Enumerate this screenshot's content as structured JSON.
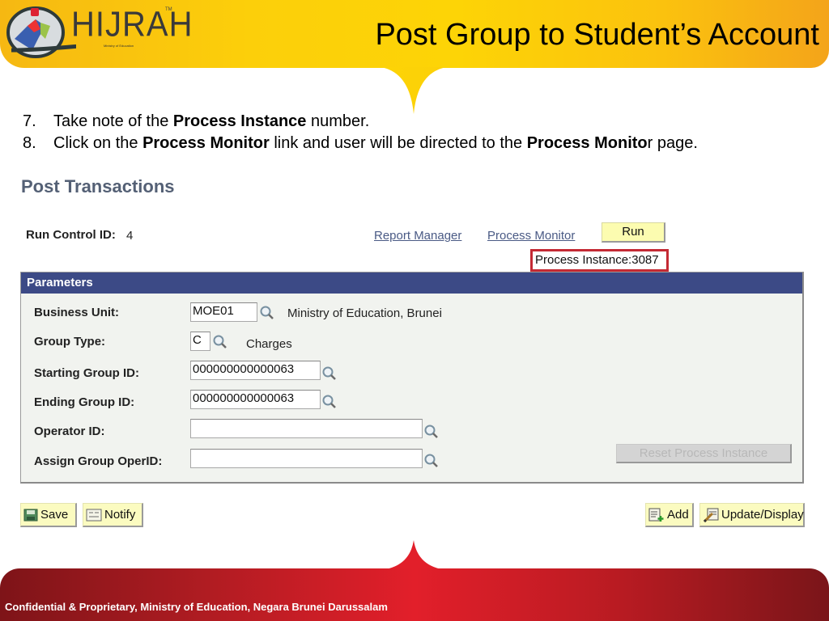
{
  "header": {
    "logo_text": "HIJRAH",
    "logo_tm": "TM",
    "logo_subtitle": "Ministry of Education",
    "title": "Post Group to Student’s Account"
  },
  "instructions": [
    {
      "num": "7.",
      "parts": [
        {
          "text": "Take note of the ",
          "bold": false
        },
        {
          "text": "Process Instance",
          "bold": true
        },
        {
          "text": " number.",
          "bold": false
        }
      ]
    },
    {
      "num": "8.",
      "parts": [
        {
          "text": "Click on the ",
          "bold": false
        },
        {
          "text": "Process Monitor",
          "bold": true
        },
        {
          "text": " link and user will be directed to the ",
          "bold": false
        },
        {
          "text": "Process Monito",
          "bold": true
        },
        {
          "text": "r page.",
          "bold": false
        }
      ]
    }
  ],
  "page": {
    "title": "Post Transactions",
    "run_control_label": "Run Control ID:",
    "run_control_value": "4",
    "report_manager_link": "Report Manager",
    "process_monitor_link": "Process Monitor",
    "run_button": "Run",
    "process_instance": "Process Instance:3087"
  },
  "parameters": {
    "header": "Parameters",
    "fields": {
      "business_unit": {
        "label": "Business Unit:",
        "value": "MOE01",
        "description": "Ministry of Education, Brunei"
      },
      "group_type": {
        "label": "Group Type:",
        "value": "C",
        "description": "Charges"
      },
      "starting_group_id": {
        "label": "Starting Group ID:",
        "value": "000000000000063"
      },
      "ending_group_id": {
        "label": "Ending Group ID:",
        "value": "000000000000063"
      },
      "operator_id": {
        "label": "Operator ID:",
        "value": ""
      },
      "assign_group_operid": {
        "label": "Assign Group OperID:",
        "value": ""
      }
    },
    "reset_button": "Reset Process Instance"
  },
  "toolbar": {
    "save": "Save",
    "notify": "Notify",
    "add": "Add",
    "update_display": "Update/Display"
  },
  "footer": {
    "text": "Confidential & Proprietary, Ministry of Education, Negara Brunei Darussalam"
  },
  "colors": {
    "banner_yellow": "#fdd406",
    "footer_red": "#e21f2a",
    "panel_header": "#3c4a86",
    "highlight_box": "#c42a34",
    "button_yellow": "#fbfbc0",
    "link": "#4a5a85"
  }
}
